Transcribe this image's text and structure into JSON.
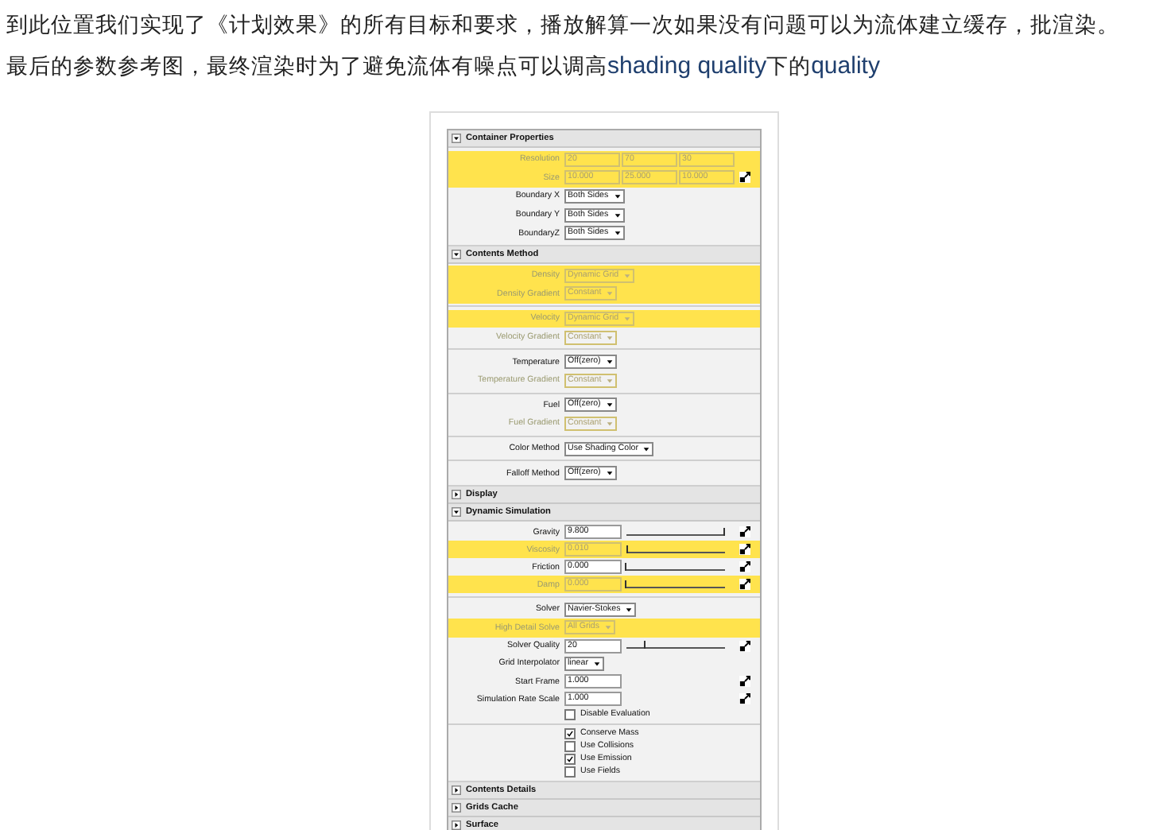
{
  "paragraphs": [
    {
      "segments": [
        {
          "kind": "cjk",
          "text": "到此位置我们实现了《计划效果》的所有目标和要求，播放解算一次如果没有问题可以为流体建立缓存，批渲染。"
        }
      ]
    },
    {
      "segments": [
        {
          "kind": "cjk",
          "text": "最后的参数参考图，最终渲染时为了避免流体有噪点可以调高"
        },
        {
          "kind": "latin",
          "text": "shading quality"
        },
        {
          "kind": "cjk",
          "text": "下的"
        },
        {
          "kind": "latin",
          "text": "quality"
        }
      ]
    }
  ],
  "panel": {
    "sections": [
      {
        "title": "Container Properties",
        "expanded": true,
        "groups": [
          [
            {
              "kind": "vector",
              "label": "Resolution",
              "values": [
                "20",
                "70",
                "30"
              ],
              "disabled": true,
              "highlighted": true,
              "map": false
            },
            {
              "kind": "vector",
              "label": "Size",
              "values": [
                "10.000",
                "25.000",
                "10.000"
              ],
              "disabled": true,
              "highlighted": true,
              "map": true
            },
            {
              "kind": "dropdown",
              "label": "Boundary X",
              "value": "Both Sides",
              "disabled": false,
              "highlighted": false
            },
            {
              "kind": "dropdown",
              "label": "Boundary Y",
              "value": "Both Sides",
              "disabled": false,
              "highlighted": false
            },
            {
              "kind": "dropdown",
              "label": "BoundaryZ",
              "value": "Both Sides",
              "disabled": false,
              "highlighted": false
            }
          ]
        ]
      },
      {
        "title": "Contents Method",
        "expanded": true,
        "groups": [
          [
            {
              "kind": "dropdown",
              "label": "Density",
              "value": "Dynamic Grid",
              "disabled": true,
              "highlighted": true
            },
            {
              "kind": "dropdown",
              "label": "Density Gradient",
              "value": "Constant",
              "disabled": true,
              "highlighted": true
            }
          ],
          [
            {
              "kind": "dropdown",
              "label": "Velocity",
              "value": "Dynamic Grid",
              "disabled": true,
              "highlighted": true
            },
            {
              "kind": "dropdown",
              "label": "Velocity Gradient",
              "value": "Constant",
              "disabled": true,
              "highlighted": false
            }
          ],
          [
            {
              "kind": "dropdown",
              "label": "Temperature",
              "value": "Off(zero)",
              "disabled": false,
              "highlighted": false
            },
            {
              "kind": "dropdown",
              "label": "Temperature Gradient",
              "value": "Constant",
              "disabled": true,
              "highlighted": false
            }
          ],
          [
            {
              "kind": "dropdown",
              "label": "Fuel",
              "value": "Off(zero)",
              "disabled": false,
              "highlighted": false
            },
            {
              "kind": "dropdown",
              "label": "Fuel Gradient",
              "value": "Constant",
              "disabled": true,
              "highlighted": false
            }
          ],
          [
            {
              "kind": "dropdown",
              "label": "Color Method",
              "value": "Use Shading Color",
              "disabled": false,
              "highlighted": false
            }
          ],
          [
            {
              "kind": "dropdown",
              "label": "Falloff Method",
              "value": "Off(zero)",
              "disabled": false,
              "highlighted": false
            }
          ]
        ]
      },
      {
        "title": "Display",
        "expanded": false
      },
      {
        "title": "Dynamic Simulation",
        "expanded": true,
        "groups": [
          [
            {
              "kind": "slider",
              "label": "Gravity",
              "value": "9.800",
              "level": 1.0,
              "disabled": false,
              "highlighted": false
            },
            {
              "kind": "slider",
              "label": "Viscosity",
              "value": "0.010",
              "level": 0.02,
              "disabled": true,
              "highlighted": true
            },
            {
              "kind": "slider",
              "label": "Friction",
              "value": "0.000",
              "level": 0.0,
              "disabled": false,
              "highlighted": false
            },
            {
              "kind": "slider",
              "label": "Damp",
              "value": "0.000",
              "level": 0.0,
              "disabled": true,
              "highlighted": true
            }
          ],
          [
            {
              "kind": "dropdown",
              "label": "Solver",
              "value": "Navier-Stokes",
              "disabled": false,
              "highlighted": false
            },
            {
              "kind": "dropdown",
              "label": "High Detail Solve",
              "value": "All Grids",
              "disabled": true,
              "highlighted": true
            },
            {
              "kind": "slider",
              "label": "Solver Quality",
              "value": "20",
              "level": 0.2,
              "disabled": false,
              "highlighted": false
            },
            {
              "kind": "dropdown",
              "label": "Grid Interpolator",
              "value": "linear",
              "disabled": false,
              "highlighted": false
            },
            {
              "kind": "field",
              "label": "Start Frame",
              "value": "1.000",
              "map": true
            },
            {
              "kind": "field",
              "label": "Simulation Rate Scale",
              "value": "1.000",
              "map": true
            },
            {
              "kind": "checkbox",
              "label": "Disable Evaluation",
              "checked": false
            }
          ],
          [
            {
              "kind": "checkbox",
              "label": "Conserve Mass",
              "checked": true
            },
            {
              "kind": "checkbox",
              "label": "Use Collisions",
              "checked": false
            },
            {
              "kind": "checkbox",
              "label": "Use Emission",
              "checked": true
            },
            {
              "kind": "checkbox",
              "label": "Use Fields",
              "checked": false
            }
          ]
        ]
      },
      {
        "title": "Contents Details",
        "expanded": false
      },
      {
        "title": "Grids Cache",
        "expanded": false
      },
      {
        "title": "Surface",
        "expanded": false
      }
    ]
  }
}
